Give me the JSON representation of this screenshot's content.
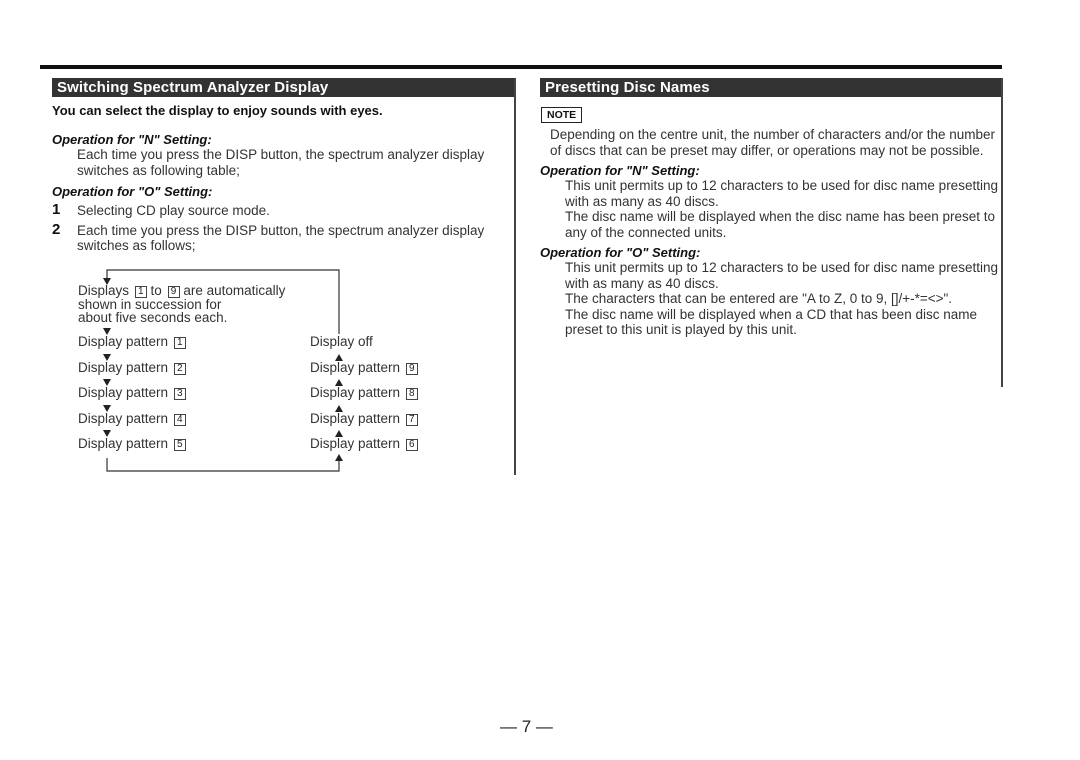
{
  "left_section": {
    "title": "Switching Spectrum Analyzer Display",
    "lead": "You can select the display to enjoy sounds with eyes.",
    "op_n_heading": "Operation for \"N\" Setting:",
    "op_n_text": "Each time you press the DISP button, the spectrum analyzer display switches as following table;",
    "op_o_heading": "Operation for \"O\" Setting:",
    "steps": [
      {
        "num": "1",
        "text": "Selecting CD play source mode."
      },
      {
        "num": "2",
        "text": "Each time you press the DISP button, the spectrum analyzer display switches as follows;"
      }
    ],
    "flow": {
      "auto_line1_a": "Displays",
      "auto_box1": "1",
      "auto_line1_b": "to",
      "auto_box2": "9",
      "auto_line1_c": "are automatically",
      "auto_line2": "shown in succession for",
      "auto_line3": "about five seconds each.",
      "pattern_label": "Display pattern",
      "left_items": [
        "1",
        "2",
        "3",
        "4",
        "5"
      ],
      "right_top": "Display off",
      "right_items": [
        "9",
        "8",
        "7",
        "6"
      ]
    }
  },
  "right_section": {
    "title": "Presetting Disc Names",
    "note_label": "NOTE",
    "note_text": "Depending on the centre unit, the number of characters and/or the number of discs that can be preset may differ, or operations may not be possible.",
    "op_n_heading": "Operation for \"N\" Setting:",
    "op_n_p1": "This unit permits up to 12 characters to be used for disc name presetting with as many as 40 discs.",
    "op_n_p2": "The disc name will be displayed when the disc name has been preset to any of the connected units.",
    "op_o_heading": "Operation for \"O\" Setting:",
    "op_o_p1": "This unit permits up to 12 characters to be used for disc name presetting with as many as 40 discs.",
    "op_o_p2": "The characters that can be entered are \"A to Z, 0 to 9, []/+-*=<>\".",
    "op_o_p3": "The disc name will be displayed when a CD that has been disc name preset to this unit is played by this unit."
  },
  "footer": {
    "page_number": "— 7 —"
  }
}
